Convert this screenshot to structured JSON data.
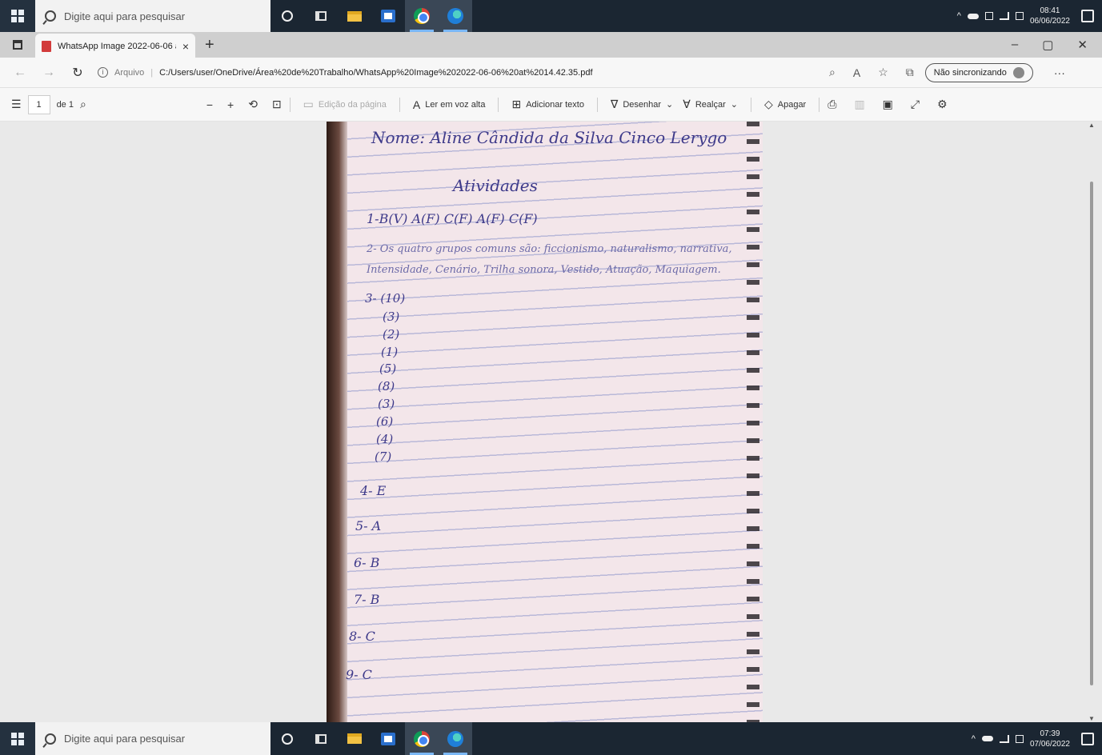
{
  "taskbar_top": {
    "search_placeholder": "Digite aqui para pesquisar",
    "time": "08:41",
    "date": "06/06/2022"
  },
  "browser": {
    "tab_title": "WhatsApp Image 2022-06-06 at",
    "tab_close": "×",
    "new_tab": "+",
    "window_controls": [
      "–",
      "▢",
      "✕"
    ],
    "back": "←",
    "forward": "→",
    "reload": "↻",
    "address": {
      "scheme_label": "Arquivo",
      "path": "C:/Users/user/OneDrive/Área%20de%20Trabalho/WhatsApp%20Image%202022-06-06%20at%2014.42.35.pdf"
    },
    "sync_label": "Não sincronizando",
    "more": "···"
  },
  "pdf_toolbar": {
    "page_current": "1",
    "page_total": "de 1",
    "page_edit_label": "Edição da página",
    "read_aloud_label": "Ler em voz alta",
    "add_text_label": "Adicionar texto",
    "draw_label": "Desenhar",
    "highlight_label": "Realçar",
    "erase_label": "Apagar"
  },
  "document": {
    "handwriting": [
      "Nome: Aline Cândida da Silva  Cinco Lerygo",
      "Atividades",
      "1-B(V) A(F) C(F) A(F) C(F)",
      "2- Os quatro grupos comuns são: ficcionismo, naturalismo, narrativa,",
      "Intensidade, Cenário, Trilha sonora, Vestido, Atuação, Maquiagem.",
      "3- (10)",
      "(3)",
      "(2)",
      "(1)",
      "(5)",
      "(8)",
      "(3)",
      "(6)",
      "(4)",
      "(7)",
      "4- E",
      "5- A",
      "6- B",
      "7- B",
      "8- C",
      "9- C"
    ]
  },
  "taskbar_bottom": {
    "search_placeholder": "Digite aqui para pesquisar",
    "time": "07:39",
    "date": "07/06/2022"
  }
}
